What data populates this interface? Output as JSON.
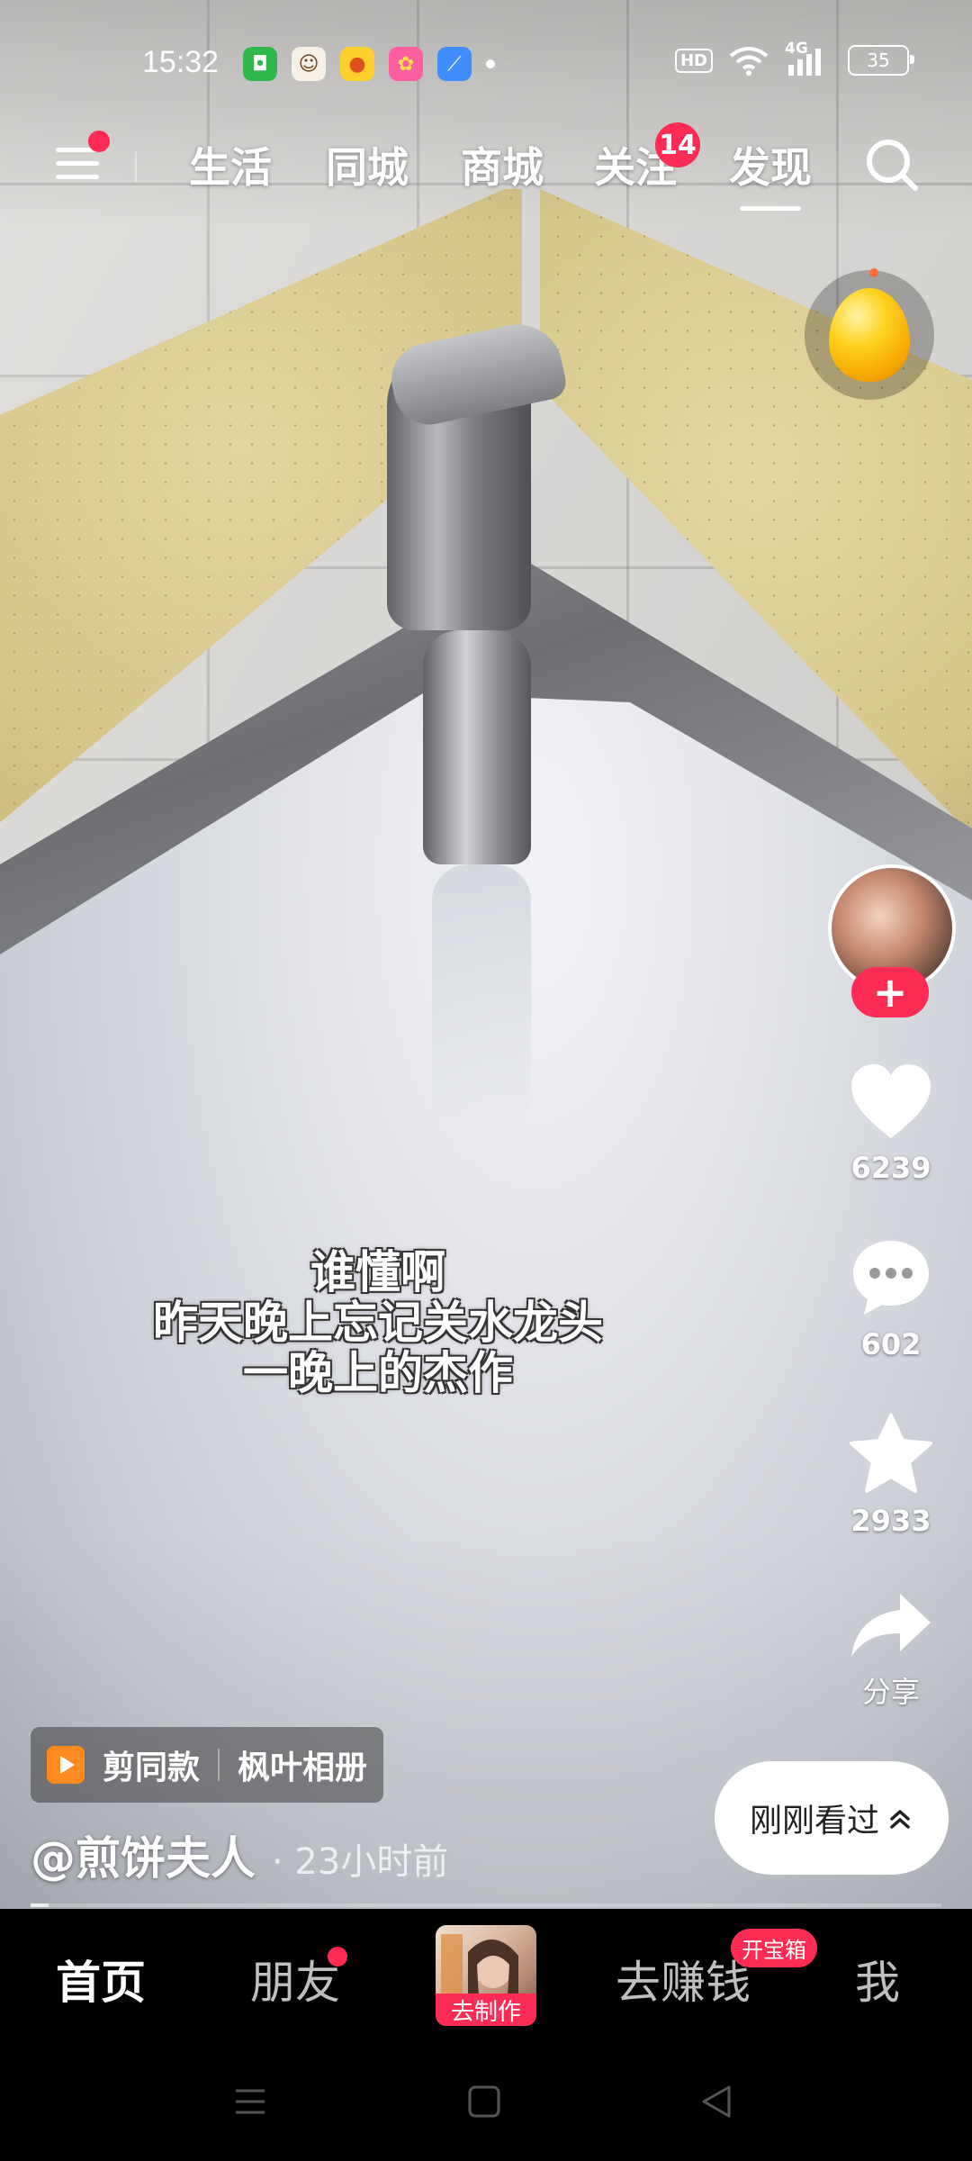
{
  "status_bar": {
    "time": "15:32",
    "notification_icons": [
      "green-shop-icon",
      "monkey-avatar-icon",
      "yellow-app-icon",
      "purple-app-icon",
      "blue-feather-icon"
    ],
    "hd_label": "HD",
    "network_label": "4G",
    "battery": "35"
  },
  "top_nav": {
    "tabs": [
      "生活",
      "同城",
      "商城",
      "关注",
      "发现"
    ],
    "active_tab": "发现",
    "follow_badge": "14",
    "accent_color": "#fe2c55"
  },
  "video": {
    "caption_lines": [
      "谁懂啊",
      "昨天晚上忘记关水龙头",
      "一晚上的杰作"
    ],
    "progress": 0.02
  },
  "actions": {
    "follow_symbol": "+",
    "like_count": "6239",
    "comment_count": "602",
    "favorite_count": "2933",
    "share_label": "分享"
  },
  "meta": {
    "template_label": "剪同款",
    "template_name": "枫叶相册",
    "author": "@煎饼夫人",
    "time_ago": "· 23小时前",
    "recently_watched": "刚刚看过"
  },
  "bottom_tabs": {
    "home": "首页",
    "friends": "朋友",
    "create": "去制作",
    "earn": "去赚钱",
    "earn_badge": "开宝箱",
    "me": "我"
  }
}
